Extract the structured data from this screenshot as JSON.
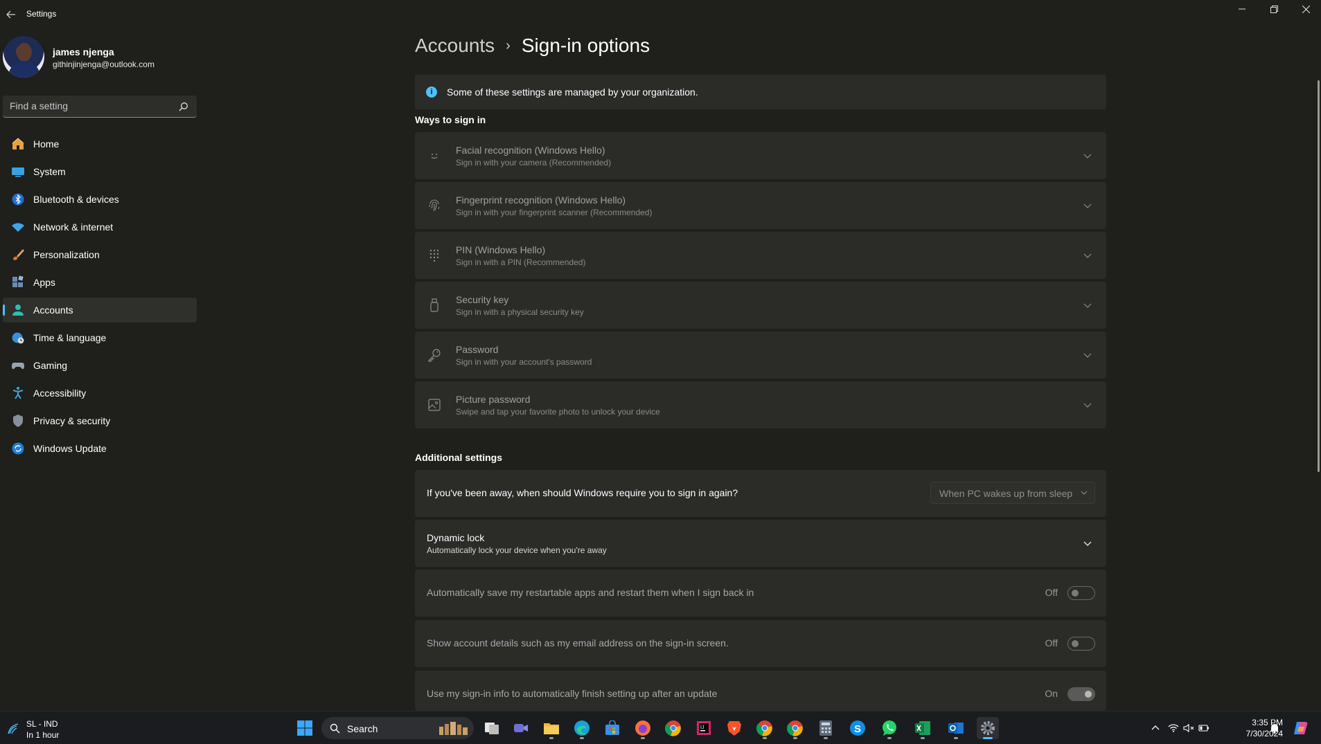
{
  "window": {
    "title": "Settings"
  },
  "profile": {
    "name": "james njenga",
    "email": "githinjinjenga@outlook.com"
  },
  "search": {
    "placeholder": "Find a setting"
  },
  "nav": {
    "items": [
      {
        "label": "Home",
        "icon": "home-icon"
      },
      {
        "label": "System",
        "icon": "monitor-icon"
      },
      {
        "label": "Bluetooth & devices",
        "icon": "bluetooth-icon"
      },
      {
        "label": "Network & internet",
        "icon": "wifi-icon"
      },
      {
        "label": "Personalization",
        "icon": "brush-icon"
      },
      {
        "label": "Apps",
        "icon": "apps-icon"
      },
      {
        "label": "Accounts",
        "icon": "person-icon",
        "active": true
      },
      {
        "label": "Time & language",
        "icon": "globe-clock-icon"
      },
      {
        "label": "Gaming",
        "icon": "gamepad-icon"
      },
      {
        "label": "Accessibility",
        "icon": "accessibility-icon"
      },
      {
        "label": "Privacy & security",
        "icon": "shield-icon"
      },
      {
        "label": "Windows Update",
        "icon": "update-icon"
      }
    ]
  },
  "breadcrumb": {
    "parent": "Accounts",
    "separator": "›",
    "current": "Sign-in options"
  },
  "info": {
    "text": "Some of these settings are managed by your organization."
  },
  "ways": {
    "title": "Ways to sign in",
    "items": [
      {
        "title": "Facial recognition (Windows Hello)",
        "subtitle": "Sign in with your camera (Recommended)",
        "icon": "face-icon"
      },
      {
        "title": "Fingerprint recognition (Windows Hello)",
        "subtitle": "Sign in with your fingerprint scanner (Recommended)",
        "icon": "fingerprint-icon"
      },
      {
        "title": "PIN (Windows Hello)",
        "subtitle": "Sign in with a PIN (Recommended)",
        "icon": "pin-keypad-icon"
      },
      {
        "title": "Security key",
        "subtitle": "Sign in with a physical security key",
        "icon": "usb-key-icon"
      },
      {
        "title": "Password",
        "subtitle": "Sign in with your account's password",
        "icon": "key-icon"
      },
      {
        "title": "Picture password",
        "subtitle": "Swipe and tap your favorite photo to unlock your device",
        "icon": "picture-icon"
      }
    ]
  },
  "additional": {
    "title": "Additional settings",
    "require_signin": {
      "label": "If you've been away, when should Windows require you to sign in again?",
      "value": "When PC wakes up from sleep"
    },
    "dynamic_lock": {
      "title": "Dynamic lock",
      "subtitle": "Automatically lock your device when you're away"
    },
    "toggles": [
      {
        "label": "Automatically save my restartable apps and restart them when I sign back in",
        "state": "Off",
        "on": false
      },
      {
        "label": "Show account details such as my email address on the sign-in screen.",
        "state": "Off",
        "on": false
      },
      {
        "label": "Use my sign-in info to automatically finish setting up after an update",
        "state": "On",
        "on": true
      }
    ]
  },
  "taskbar": {
    "weather": {
      "line1": "SL - IND",
      "line2": "In 1 hour"
    },
    "search_label": "Search",
    "clock": {
      "time": "3:35 PM",
      "date": "7/30/2024"
    }
  },
  "colors": {
    "accent": "#4cc2ff",
    "background": "#1f1f1b",
    "card": "#2b2b28"
  }
}
